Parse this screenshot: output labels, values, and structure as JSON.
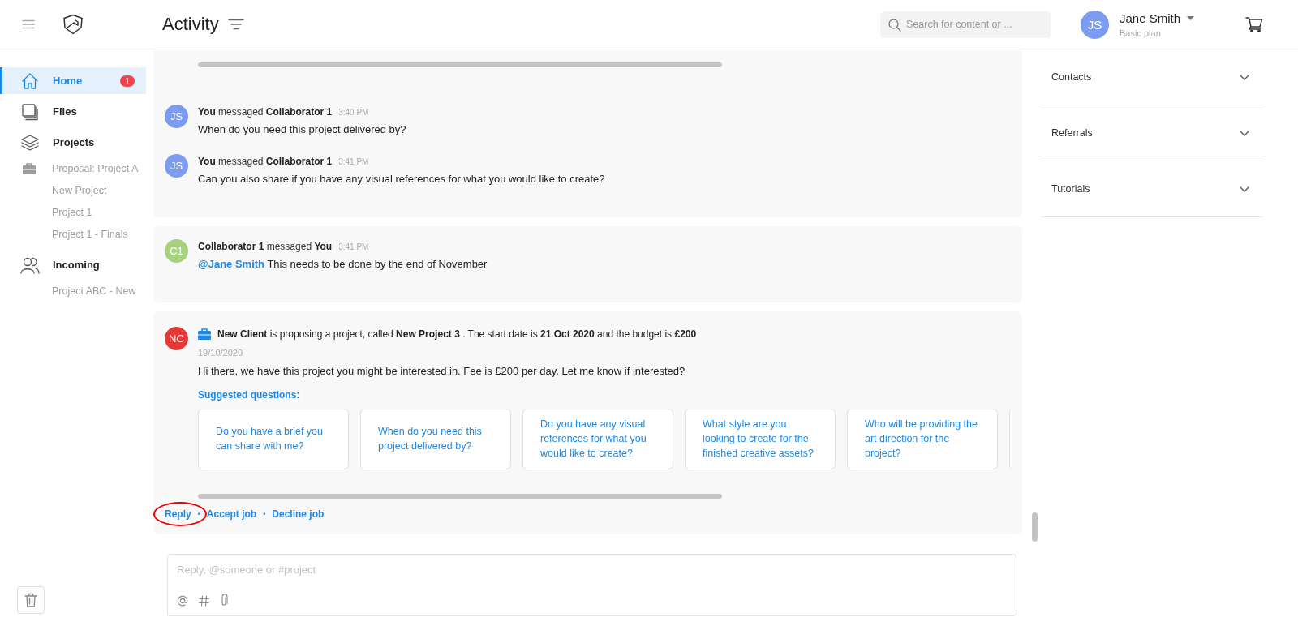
{
  "header": {
    "title": "Activity",
    "search": {
      "placeholder": "Search for content or ..."
    },
    "user": {
      "initials": "JS",
      "color": "#7b9cf0",
      "name": "Jane Smith",
      "plan": "Basic plan"
    }
  },
  "sidebar": {
    "items": [
      {
        "kind": "home",
        "label": "Home",
        "selected": true,
        "badge": "1"
      },
      {
        "kind": "files",
        "label": "Files",
        "selected": false
      },
      {
        "kind": "projects",
        "label": "Projects",
        "selected": false,
        "children": [
          {
            "kind": "proposal",
            "label": "Proposal: Project A",
            "selected": false
          },
          {
            "kind": "project",
            "label": "New Project",
            "selected": false
          },
          {
            "kind": "project",
            "label": "Project 1",
            "selected": false
          },
          {
            "kind": "project",
            "label": "Project 1 - Finals",
            "selected": false
          }
        ]
      },
      {
        "kind": "incoming",
        "label": "Incoming",
        "selected": false,
        "children": [
          {
            "kind": "project",
            "label": "Project ABC - New",
            "selected": false
          }
        ]
      }
    ]
  },
  "feed": {
    "cards": [
      {
        "kind": "thread",
        "messages": [
          {
            "initials": "JS",
            "color": "#7b9cf0",
            "heading": "**You** messaged **Collaborator 1**",
            "time": "3:40 PM",
            "text": "When do you need this project delivered by?"
          },
          {
            "initials": "JS",
            "color": "#7b9cf0",
            "heading": "**You** messaged **Collaborator 1**",
            "time": "3:41 PM",
            "text": "Can you also share if you have any visual references for what you would like to create?"
          }
        ]
      },
      {
        "kind": "thread",
        "messages": [
          {
            "initials": "C1",
            "color": "#a8d17f",
            "heading": "**Collaborator 1** messaged **You**",
            "time": "3:41 PM",
            "mention": "@Jane Smith",
            "text": "This needs to be done by the end of November"
          }
        ]
      },
      {
        "kind": "proposal",
        "initials": "NC",
        "color": "#e53935",
        "summary": "**New Client** is proposing a project, called **New Project 3** . The start date is **21 Oct 2020** and the budget is **£200**",
        "date": "19/10/2020",
        "text": "Hi there, we have this project you might be interested in. Fee is £200 per day. Let me know if interested?",
        "suggestions_label": "Suggested questions:",
        "suggestions": [
          "Do you have a brief you can share with me?",
          "When do you need this project delivered by?",
          "Do you have any visual references for what you would like to create?",
          "What style are you looking to create for the finished creative assets?",
          "Who will be providing the art direction for the project?"
        ],
        "more_suggestions_clipped": true,
        "actions": {
          "separator": "•",
          "items": [
            {
              "label": "Reply",
              "highlighted": true
            },
            {
              "label": "Accept job",
              "highlighted": false
            },
            {
              "label": "Decline job",
              "highlighted": false
            }
          ]
        }
      }
    ]
  },
  "composer": {
    "placeholder": "Reply, @someone or #project"
  },
  "panel": {
    "sections": [
      {
        "label": "Contacts",
        "expanded": false
      },
      {
        "label": "Referrals",
        "expanded": false
      },
      {
        "label": "Tutorials",
        "expanded": false
      }
    ]
  }
}
